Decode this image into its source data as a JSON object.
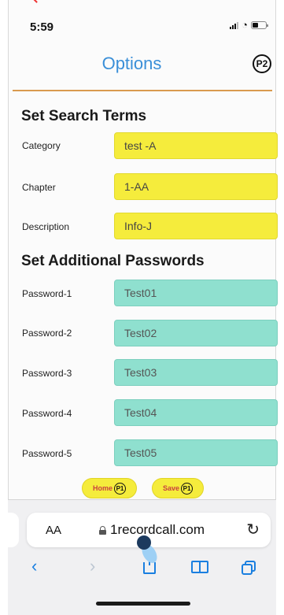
{
  "status_bar": {
    "time": "5:59"
  },
  "header": {
    "title": "Options",
    "badge": "P2"
  },
  "search_section": {
    "title": "Set Search Terms",
    "rows": [
      {
        "label": "Category",
        "value": "test -A"
      },
      {
        "label": "Chapter",
        "value": "1-AA"
      },
      {
        "label": "Description",
        "value": "Info-J"
      }
    ]
  },
  "password_section": {
    "title": "Set Additional Passwords",
    "rows": [
      {
        "label": "Password-1",
        "value": "Test01"
      },
      {
        "label": "Password-2",
        "value": "Test02"
      },
      {
        "label": "Password-3",
        "value": "Test03"
      },
      {
        "label": "Password-4",
        "value": "Test04"
      },
      {
        "label": "Password-5",
        "value": "Test05"
      }
    ]
  },
  "actions": {
    "home_label": "Home",
    "home_badge": "P1",
    "save_label": "Save",
    "save_badge": "P1"
  },
  "browser": {
    "text_size_button": "AA",
    "url": "1recordcall.com"
  },
  "colors": {
    "title_blue": "#3a8fd8",
    "divider_orange": "#d99a4e",
    "search_field_yellow": "#f5ec3c",
    "password_field_teal": "#8fe0cf",
    "action_text_red": "#c94040",
    "browser_accent": "#1a7fe0"
  },
  "icons": {
    "back": "chevron-left-icon",
    "forward": "chevron-right-icon",
    "share": "share-icon",
    "bookmarks": "book-icon",
    "tabs": "tabs-icon",
    "reload": "reload-icon",
    "lock": "lock-icon"
  }
}
